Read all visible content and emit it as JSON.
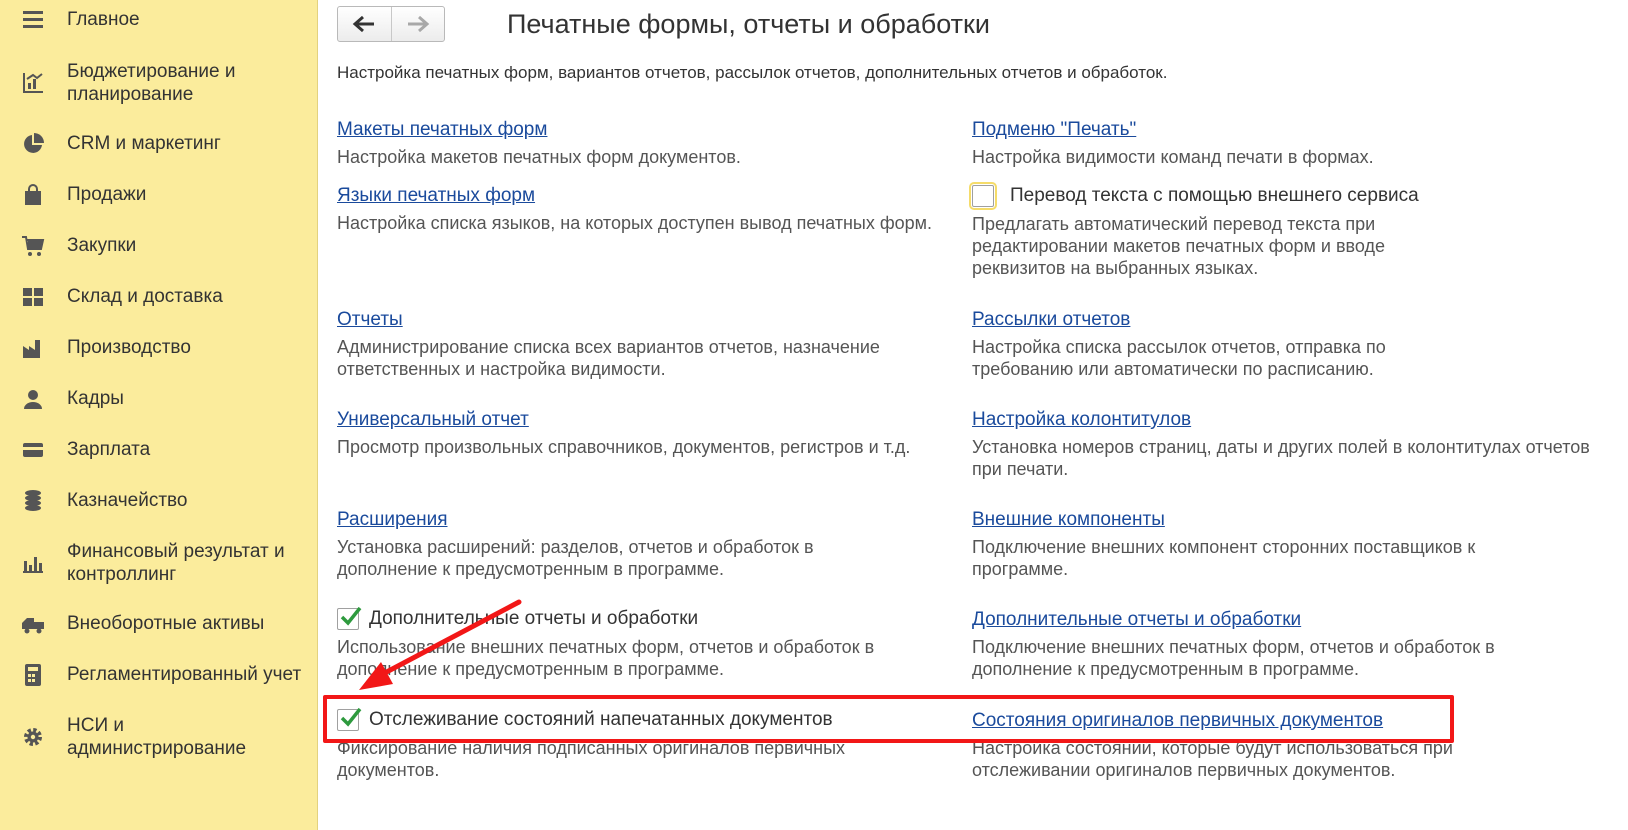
{
  "sidebar": {
    "items": [
      {
        "label": "Главное",
        "icon": "menu-icon"
      },
      {
        "label": "Бюджетирование и планирование",
        "icon": "budget-icon"
      },
      {
        "label": "CRM и маркетинг",
        "icon": "pie-chart-icon"
      },
      {
        "label": "Продажи",
        "icon": "shopping-bag-icon"
      },
      {
        "label": "Закупки",
        "icon": "cart-icon"
      },
      {
        "label": "Склад и доставка",
        "icon": "warehouse-icon"
      },
      {
        "label": "Производство",
        "icon": "factory-icon"
      },
      {
        "label": "Кадры",
        "icon": "person-icon"
      },
      {
        "label": "Зарплата",
        "icon": "card-icon"
      },
      {
        "label": "Казначейство",
        "icon": "coins-icon"
      },
      {
        "label": "Финансовый результат и контроллинг",
        "icon": "bar-chart-icon"
      },
      {
        "label": "Внеоборотные активы",
        "icon": "truck-icon"
      },
      {
        "label": "Регламентированный учет",
        "icon": "calculator-icon"
      },
      {
        "label": "НСИ и администрирование",
        "icon": "gear-icon"
      }
    ]
  },
  "header": {
    "title": "Печатные формы, отчеты и обработки",
    "subtitle": "Настройка печатных форм, вариантов отчетов, рассылок отчетов, дополнительных отчетов и обработок.",
    "back_icon": "arrow-left-icon",
    "forward_icon": "arrow-right-icon"
  },
  "left_column": [
    {
      "type": "link",
      "title": "Макеты печатных форм",
      "desc": "Настройка макетов печатных форм документов."
    },
    {
      "type": "link",
      "title": "Языки печатных форм",
      "desc": "Настройка списка языков, на которых доступен вывод печатных форм."
    },
    {
      "type": "link",
      "title": "Отчеты",
      "desc": "Администрирование списка всех вариантов отчетов, назначение ответственных и настройка видимости."
    },
    {
      "type": "link",
      "title": "Универсальный отчет",
      "desc": "Просмотр произвольных справочников, документов, регистров и т.д."
    },
    {
      "type": "link",
      "title": "Расширения",
      "desc": "Установка расширений: разделов, отчетов и обработок в дополнение к предусмотренным в программе."
    },
    {
      "type": "checkbox",
      "checked": true,
      "title": "Дополнительные отчеты и обработки",
      "desc": "Использование внешних печатных форм, отчетов и обработок в дополнение к предусмотренным в программе."
    },
    {
      "type": "checkbox",
      "checked": true,
      "title": "Отслеживание состояний напечатанных документов",
      "desc": "Фиксирование наличия подписанных оригиналов первичных документов."
    }
  ],
  "right_column": [
    {
      "type": "link",
      "title": "Подменю \"Печать\"",
      "desc": "Настройка видимости команд печати в формах."
    },
    {
      "type": "checkbox",
      "checked": false,
      "title": "Перевод текста с помощью внешнего сервиса",
      "desc": "Предлагать автоматический перевод текста при редактировании макетов печатных форм и вводе реквизитов на выбранных языках."
    },
    {
      "type": "link",
      "title": "Рассылки отчетов",
      "desc": "Настройка списка рассылок отчетов, отправка по требованию или автоматически по расписанию."
    },
    {
      "type": "link",
      "title": "Настройка колонтитулов",
      "desc": "Установка номеров страниц, даты и других полей в колонтитулах отчетов при печати."
    },
    {
      "type": "link",
      "title": "Внешние компоненты",
      "desc": "Подключение внешних компонент сторонних поставщиков к программе."
    },
    {
      "type": "link",
      "title": "Дополнительные отчеты и обработки",
      "desc": "Подключение внешних печатных форм, отчетов и обработок в дополнение к предусмотренным в программе."
    },
    {
      "type": "link",
      "title": "Состояния оригиналов первичных документов",
      "desc": "Настройка состояний, которые будут использоваться при отслеживании оригиналов первичных документов."
    }
  ],
  "colors": {
    "sidebar_bg": "#fbec9c",
    "link": "#1a4a9c",
    "check": "#2e9a3e",
    "annotation": "#f21717"
  }
}
